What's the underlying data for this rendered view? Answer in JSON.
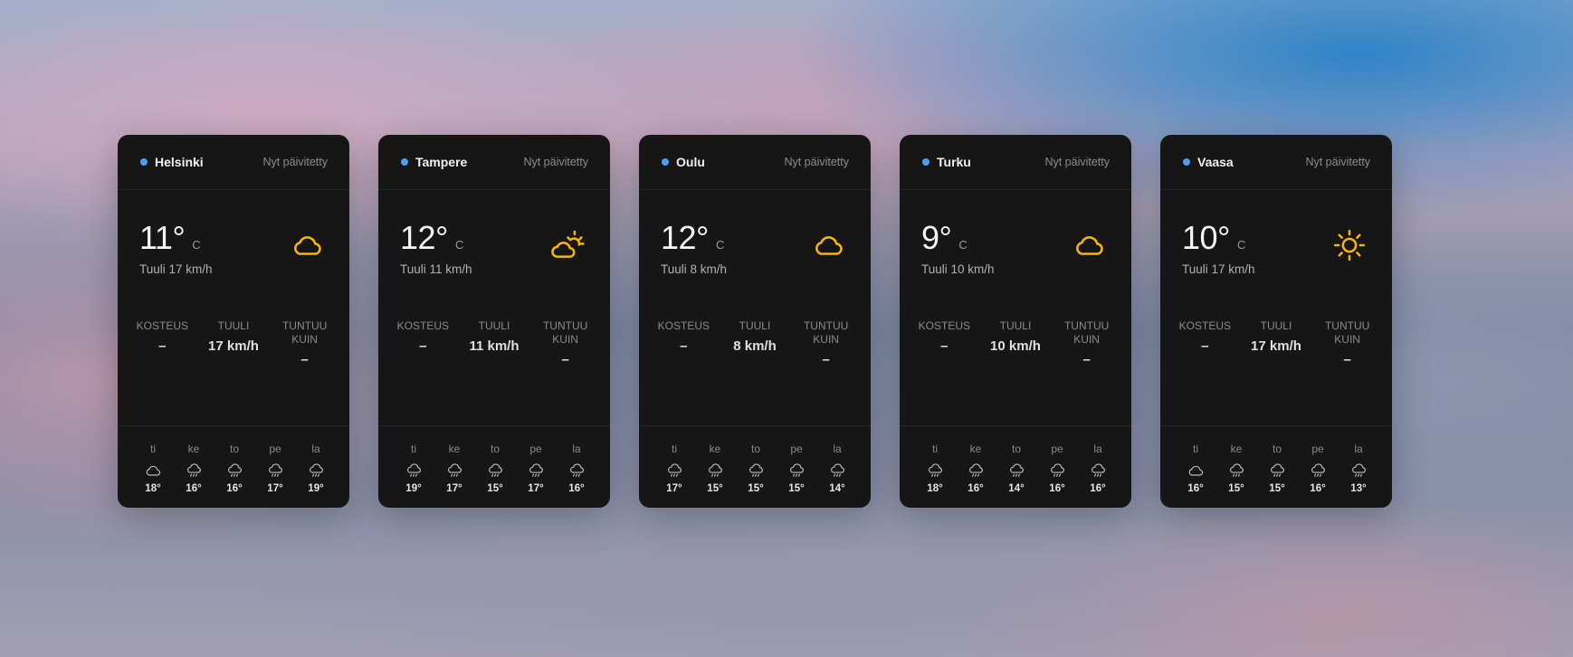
{
  "labels": {
    "humidity": "KOSTEUS",
    "wind": "TUULI",
    "feels_like": "TUNTUU KUIN"
  },
  "colors": {
    "accent_dot": "#4aa0f5",
    "weather_icon": "#f5b500",
    "card_bg": "#161616"
  },
  "cities": [
    {
      "name": "Helsinki",
      "updated": "Nyt päivitetty",
      "temp": "11°",
      "unit": "C",
      "wind_line": "Tuuli 17 km/h",
      "icon": "cloud-icon",
      "humidity": "–",
      "wind_value": "17 km/h",
      "feels_like": "–",
      "forecast": [
        {
          "day": "ti",
          "temp": "18°",
          "icon": "cloud-icon"
        },
        {
          "day": "ke",
          "temp": "16°",
          "icon": "rain-icon"
        },
        {
          "day": "to",
          "temp": "16°",
          "icon": "rain-icon"
        },
        {
          "day": "pe",
          "temp": "17°",
          "icon": "rain-icon"
        },
        {
          "day": "la",
          "temp": "19°",
          "icon": "rain-icon"
        }
      ]
    },
    {
      "name": "Tampere",
      "updated": "Nyt päivitetty",
      "temp": "12°",
      "unit": "C",
      "wind_line": "Tuuli 11 km/h",
      "icon": "partly-sunny-icon",
      "humidity": "–",
      "wind_value": "11 km/h",
      "feels_like": "–",
      "forecast": [
        {
          "day": "ti",
          "temp": "19°",
          "icon": "rain-icon"
        },
        {
          "day": "ke",
          "temp": "17°",
          "icon": "rain-icon"
        },
        {
          "day": "to",
          "temp": "15°",
          "icon": "rain-icon"
        },
        {
          "day": "pe",
          "temp": "17°",
          "icon": "rain-icon"
        },
        {
          "day": "la",
          "temp": "16°",
          "icon": "rain-icon"
        }
      ]
    },
    {
      "name": "Oulu",
      "updated": "Nyt päivitetty",
      "temp": "12°",
      "unit": "C",
      "wind_line": "Tuuli 8 km/h",
      "icon": "cloud-icon",
      "humidity": "–",
      "wind_value": "8 km/h",
      "feels_like": "–",
      "forecast": [
        {
          "day": "ti",
          "temp": "17°",
          "icon": "rain-icon"
        },
        {
          "day": "ke",
          "temp": "15°",
          "icon": "rain-icon"
        },
        {
          "day": "to",
          "temp": "15°",
          "icon": "rain-icon"
        },
        {
          "day": "pe",
          "temp": "15°",
          "icon": "rain-icon"
        },
        {
          "day": "la",
          "temp": "14°",
          "icon": "rain-icon"
        }
      ]
    },
    {
      "name": "Turku",
      "updated": "Nyt päivitetty",
      "temp": "9°",
      "unit": "C",
      "wind_line": "Tuuli 10 km/h",
      "icon": "cloud-icon",
      "humidity": "–",
      "wind_value": "10 km/h",
      "feels_like": "–",
      "forecast": [
        {
          "day": "ti",
          "temp": "18°",
          "icon": "rain-icon"
        },
        {
          "day": "ke",
          "temp": "16°",
          "icon": "rain-icon"
        },
        {
          "day": "to",
          "temp": "14°",
          "icon": "rain-icon"
        },
        {
          "day": "pe",
          "temp": "16°",
          "icon": "rain-icon"
        },
        {
          "day": "la",
          "temp": "16°",
          "icon": "rain-icon"
        }
      ]
    },
    {
      "name": "Vaasa",
      "updated": "Nyt päivitetty",
      "temp": "10°",
      "unit": "C",
      "wind_line": "Tuuli 17 km/h",
      "icon": "sun-icon",
      "humidity": "–",
      "wind_value": "17 km/h",
      "feels_like": "–",
      "forecast": [
        {
          "day": "ti",
          "temp": "16°",
          "icon": "cloud-icon"
        },
        {
          "day": "ke",
          "temp": "15°",
          "icon": "rain-icon"
        },
        {
          "day": "to",
          "temp": "15°",
          "icon": "rain-icon"
        },
        {
          "day": "pe",
          "temp": "16°",
          "icon": "rain-icon"
        },
        {
          "day": "la",
          "temp": "13°",
          "icon": "rain-icon"
        }
      ]
    }
  ]
}
